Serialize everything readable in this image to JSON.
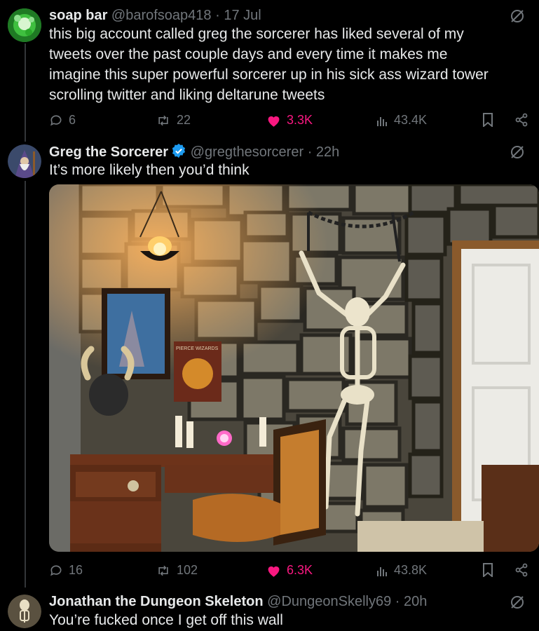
{
  "tweets": [
    {
      "name": "soap bar",
      "handle": "@barofsoap418",
      "separator": "·",
      "time": "17 Jul",
      "text_lines": [
        "this big account called greg the sorcerer has liked several of my",
        "tweets over the past couple days and every time it makes me",
        "imagine this super powerful sorcerer up in his sick ass wizard tower",
        "scrolling twitter and liking deltarune tweets"
      ],
      "replies": "6",
      "retweets": "22",
      "likes": "3.3K",
      "views": "43.4K"
    },
    {
      "name": "Greg the Sorcerer",
      "handle": "@gregthesorcerer",
      "separator": "·",
      "time": "22h",
      "text": "It’s more likely then you’d think",
      "photo_poster_text": "PIERCE WIZARDS",
      "replies": "16",
      "retweets": "102",
      "likes": "6.3K",
      "views": "43.8K"
    },
    {
      "name": "Jonathan the Dungeon Skeleton",
      "handle": "@DungeonSkelly69",
      "separator": "·",
      "time": "20h",
      "text": "You’re fucked once I get off this wall"
    }
  ],
  "colors": {
    "background": "#000000",
    "text": "#e7e9ea",
    "muted": "#71767b",
    "like": "#f91880",
    "verified": "#1d9bf0",
    "thread_line": "#333639"
  },
  "icons": [
    "reply-icon",
    "retweet-icon",
    "heart-icon",
    "views-icon",
    "bookmark-icon",
    "share-icon",
    "grok-icon",
    "verified-icon"
  ]
}
